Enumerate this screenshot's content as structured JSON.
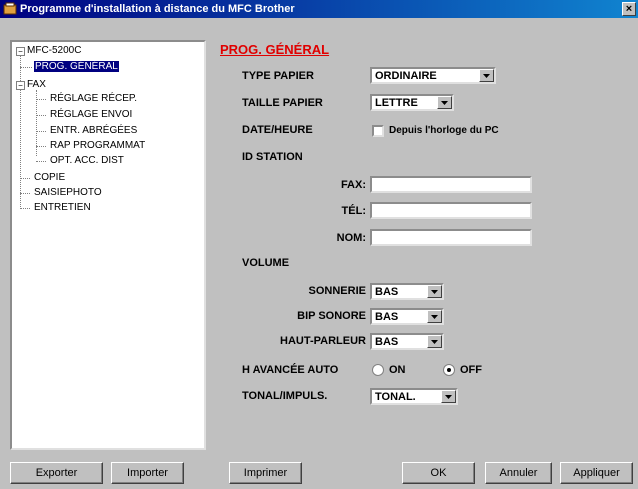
{
  "window": {
    "title": "Programme d'installation à distance du MFC Brother",
    "close_label": "×"
  },
  "tree": {
    "root": "MFC-5200C",
    "root_expander": "−",
    "prog_general": "PROG. GÉNÉRAL",
    "fax": "FAX",
    "fax_expander": "−",
    "fax_children": [
      "RÉGLAGE RÉCEP.",
      "RÉGLAGE ENVOI",
      "ENTR. ABRÉGÉES",
      "RAP PROGRAMMAT",
      "OPT. ACC. DIST"
    ],
    "copie": "COPIE",
    "saisiephoto": "SAISIEPHOTO",
    "entretien": "ENTRETIEN"
  },
  "form": {
    "section_title": "PROG. GÉNÉRAL",
    "type_papier": {
      "label": "TYPE PAPIER",
      "value": "ORDINAIRE"
    },
    "taille_papier": {
      "label": "TAILLE PAPIER",
      "value": "LETTRE"
    },
    "date_heure": {
      "label": "DATE/HEURE",
      "checkbox_label": "Depuis l'horloge du PC",
      "checked": false
    },
    "id_station": {
      "label": "ID STATION",
      "fax_label": "FAX:",
      "fax_value": "",
      "tel_label": "TÉL:",
      "tel_value": "",
      "nom_label": "NOM:",
      "nom_value": ""
    },
    "volume": {
      "label": "VOLUME",
      "sonnerie": {
        "label": "SONNERIE",
        "value": "BAS"
      },
      "bip_sonore": {
        "label": "BIP SONORE",
        "value": "BAS"
      },
      "haut_parleur": {
        "label": "HAUT-PARLEUR",
        "value": "BAS"
      }
    },
    "h_avancee_auto": {
      "label": "H AVANCÉE AUTO",
      "on_label": "ON",
      "off_label": "OFF",
      "selected": "OFF"
    },
    "tonal_impuls": {
      "label": "TONAL/IMPULS.",
      "value": "TONAL."
    }
  },
  "buttons": {
    "exporter": "Exporter",
    "importer": "Importer",
    "imprimer": "Imprimer",
    "ok": "OK",
    "annuler": "Annuler",
    "appliquer": "Appliquer"
  }
}
